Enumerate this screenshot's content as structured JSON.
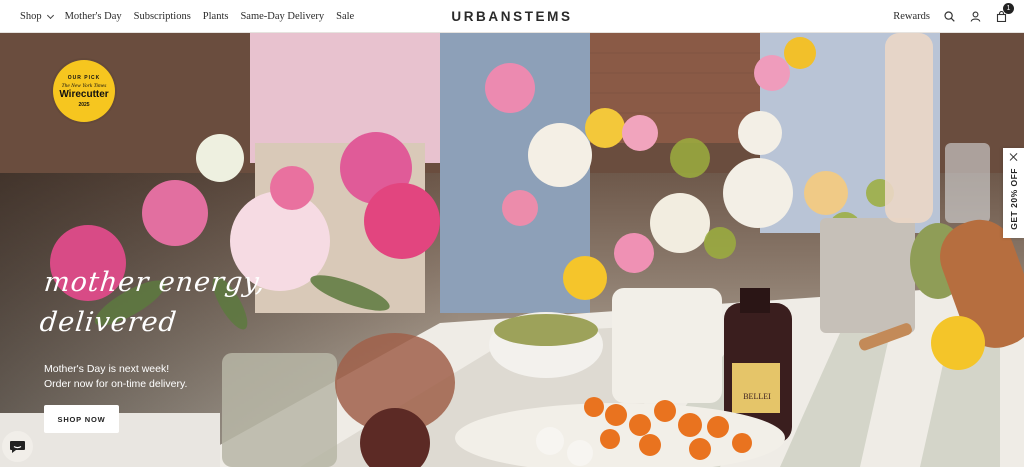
{
  "header": {
    "nav": [
      {
        "label": "Shop",
        "has_dropdown": true
      },
      {
        "label": "Mother's Day"
      },
      {
        "label": "Subscriptions"
      },
      {
        "label": "Plants"
      },
      {
        "label": "Same-Day Delivery"
      },
      {
        "label": "Sale"
      }
    ],
    "logo": "URBANSTEMS",
    "rewards_label": "Rewards",
    "cart_count": "1",
    "icons": [
      "search-icon",
      "account-icon",
      "cart-icon"
    ]
  },
  "hero": {
    "badge": {
      "top": "OUR PICK",
      "publication": "The New York Times",
      "brand": "Wirecutter",
      "year": "2025"
    },
    "headline_line1": "mother energy,",
    "headline_line2": "delivered",
    "subtitle_line1": "Mother's Day is next week!",
    "subtitle_line2": "Order now for on-time delivery.",
    "cta_label": "SHOP NOW",
    "bottle_label": "BELLEI"
  },
  "promo_tab": {
    "label": "GET 20% OFF"
  },
  "colors": {
    "badge_yellow": "#f6c61f",
    "header_bg": "#ffffff",
    "text_dark": "#2b2b2b"
  }
}
